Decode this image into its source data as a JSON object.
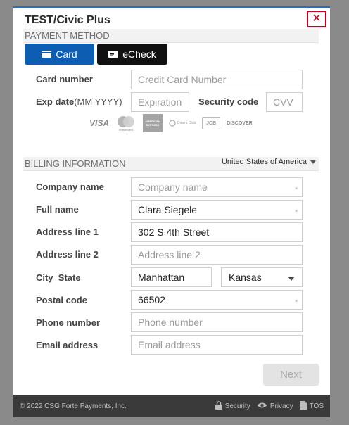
{
  "modal": {
    "title": "TEST/Civic Plus",
    "close_glyph": "✕"
  },
  "payment": {
    "header": "PAYMENT METHOD",
    "tabs": [
      {
        "label": "Card"
      },
      {
        "label": "eCheck"
      }
    ],
    "card_number": {
      "label": "Card number",
      "placeholder": "Credit Card Number"
    },
    "exp_date": {
      "label": "Exp date",
      "label_hint": "(MM YYYY)",
      "placeholder": "Expiration"
    },
    "security_code": {
      "label": "Security code",
      "placeholder": "CVV"
    },
    "logos": {
      "visa": "VISA",
      "mastercard": "mastercard",
      "amex": "AMERICAN EXPRESS",
      "diners": "Diners Club",
      "jcb": "JCB",
      "discover": "DISCOVER"
    }
  },
  "billing": {
    "header": "BILLING INFORMATION",
    "country": "United States of America",
    "company_name": {
      "label": "Company name",
      "placeholder": "Company name",
      "value": ""
    },
    "full_name": {
      "label": "Full name",
      "value": "Clara Siegele"
    },
    "address1": {
      "label": "Address line 1",
      "value": "302 S 4th Street"
    },
    "address2": {
      "label": "Address line 2",
      "placeholder": "Address line 2",
      "value": ""
    },
    "city_state_label": "City  State",
    "city": {
      "value": "Manhattan"
    },
    "state": {
      "value": "Kansas"
    },
    "postal_code": {
      "label": "Postal code",
      "value": "66502"
    },
    "phone": {
      "label": "Phone number",
      "placeholder": "Phone number",
      "value": ""
    },
    "email": {
      "label": "Email address",
      "placeholder": "Email address",
      "value": ""
    },
    "required_mark": "*"
  },
  "actions": {
    "next_label": "Next"
  },
  "footer": {
    "copyright": "© 2022 CSG Forte Payments, Inc.",
    "links": [
      {
        "label": "Security"
      },
      {
        "label": "Privacy"
      },
      {
        "label": "TOS"
      }
    ]
  },
  "colors": {
    "accent": "#1f6fc4",
    "card_tab": "#0d5eb2",
    "echeck_tab": "#111111",
    "close_border": "#c4001f",
    "footer_bg": "#3a3a3a"
  }
}
